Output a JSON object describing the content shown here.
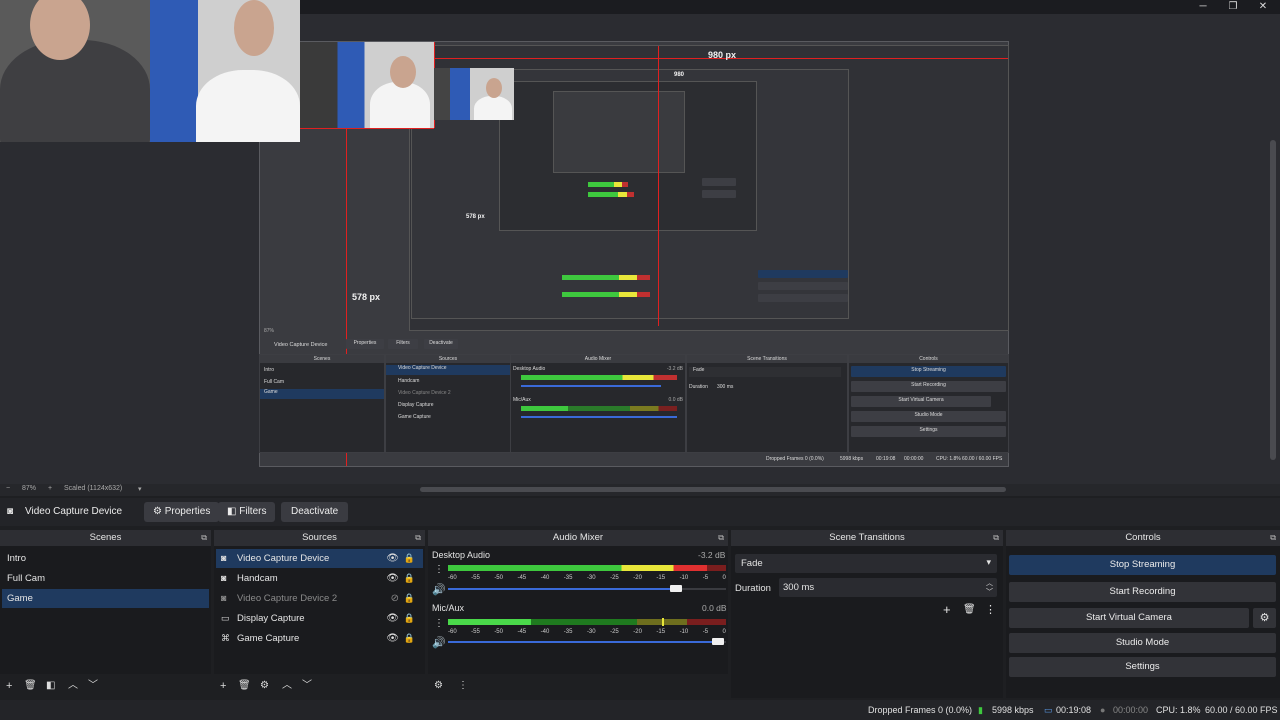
{
  "window": {
    "minimize": "─",
    "maximize": "❐",
    "close": "✕"
  },
  "preview": {
    "labels": {
      "width_label": "980 px",
      "height_label": "578 px",
      "nested_width_label": "980",
      "nested_height_label": "578 px"
    },
    "zoom": "87%",
    "scale_text": "Scaled (1124x632)",
    "mini": {
      "context_source": "Video Capture Device",
      "properties": "Properties",
      "filters": "Filters",
      "deactivate": "Deactivate",
      "scenes_title": "Scenes",
      "sources_title": "Sources",
      "mixer_title": "Audio Mixer",
      "transitions_title": "Scene Transitions",
      "controls_title": "Controls",
      "scenes": [
        "Intro",
        "Full Cam",
        "Game"
      ],
      "sources": [
        "Video Capture Device",
        "Handcam",
        "Video Capture Device 2",
        "Display Capture",
        "Game Capture"
      ],
      "desktop": "Desktop Audio",
      "desktop_db": "-3.2 dB",
      "mic": "Mic/Aux",
      "mic_db": "0.0 dB",
      "fade": "Fade",
      "duration_label": "Duration",
      "duration_value": "300 ms",
      "controls": [
        "Stop Streaming",
        "Start Recording",
        "Start Virtual Camera",
        "Studio Mode",
        "Settings"
      ],
      "status": [
        "Dropped Frames 0 (0.0%)",
        "5998 kbps",
        "00:19:08",
        "00:00:00",
        "CPU: 1.8%",
        "60.00 / 60.00 FPS"
      ]
    }
  },
  "context_bar": {
    "source_name": "Video Capture Device",
    "properties": "Properties",
    "filters": "Filters",
    "deactivate": "Deactivate"
  },
  "scenes": {
    "title": "Scenes",
    "items": [
      "Intro",
      "Full Cam",
      "Game"
    ],
    "selected_index": 2
  },
  "sources": {
    "title": "Sources",
    "items": [
      {
        "label": "Video Capture Device",
        "icon": "camera-icon",
        "visible": true
      },
      {
        "label": "Handcam",
        "icon": "camera-icon",
        "visible": true
      },
      {
        "label": "Video Capture Device 2",
        "icon": "camera-icon",
        "visible": false
      },
      {
        "label": "Display Capture",
        "icon": "monitor-icon",
        "visible": true
      },
      {
        "label": "Game Capture",
        "icon": "gamepad-icon",
        "visible": true
      }
    ],
    "selected_index": 0
  },
  "audio_mixer": {
    "title": "Audio Mixer",
    "scale": [
      "-60",
      "-55",
      "-50",
      "-45",
      "-40",
      "-35",
      "-30",
      "-25",
      "-20",
      "-15",
      "-10",
      "-5",
      "0"
    ],
    "channels": [
      {
        "name": "Desktop Audio",
        "db": "-3.2 dB",
        "level": 0.93,
        "volume": 0.82
      },
      {
        "name": "Mic/Aux",
        "db": "0.0 dB",
        "level": 0.3,
        "volume": 0.97
      }
    ]
  },
  "scene_transitions": {
    "title": "Scene Transitions",
    "transition": "Fade",
    "duration_label": "Duration",
    "duration_value": "300 ms"
  },
  "controls": {
    "title": "Controls",
    "stop_streaming": "Stop Streaming",
    "start_recording": "Start Recording",
    "start_virtual_camera": "Start Virtual Camera",
    "studio_mode": "Studio Mode",
    "settings": "Settings"
  },
  "status_bar": {
    "dropped_frames": "Dropped Frames 0 (0.0%)",
    "bitrate": "5998 kbps",
    "stream_time": "00:19:08",
    "record_time": "00:00:00",
    "cpu": "CPU: 1.8%",
    "fps": "60.00 / 60.00 FPS"
  },
  "colors": {
    "accent_selected": "#1f3a5f",
    "meter_green": "#3ec83e",
    "meter_yellow": "#e8e63a",
    "meter_red": "#c03030",
    "guide_red": "#e02020"
  }
}
